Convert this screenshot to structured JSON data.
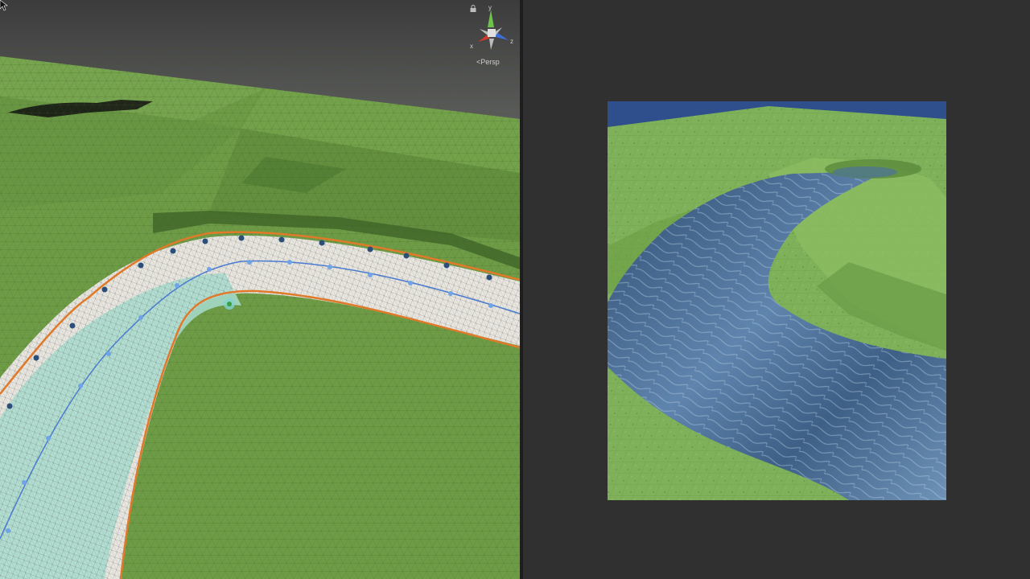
{
  "scene_view": {
    "projection_label": "<Persp",
    "gizmo": {
      "axis_y_label": "y",
      "axis_x_label": "x",
      "axis_z_label": "z",
      "icons": [
        "orientation-gizmo-icon",
        "lock-icon"
      ]
    },
    "colors": {
      "terrain": "#6e9c46",
      "spline_outline": "#e07a2a",
      "spline_center": "#4a7bd0",
      "control_point": "#2b4f7a",
      "river_mesh": "#e8e6df",
      "river_mesh_shallow": "#a8dcd0"
    }
  },
  "game_view": {
    "colors": {
      "sky": "#2e4f8c",
      "grass": "#7fb15a",
      "water": "#3e5f86"
    }
  }
}
